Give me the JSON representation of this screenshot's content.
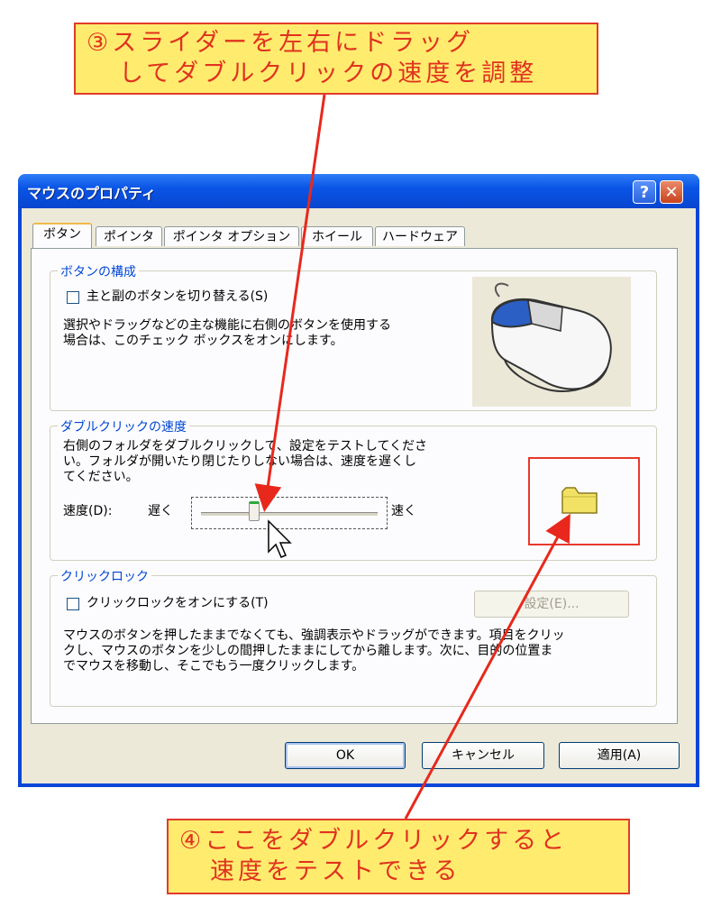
{
  "annotations": {
    "top_line1": "③スライダーを左右にドラッグ",
    "top_line2": "してダブルクリックの速度を調整",
    "bottom_line1": "④ここをダブルクリックすると",
    "bottom_line2": "速度をテストできる",
    "color": "#e0321f",
    "bg": "#ffec6e"
  },
  "window": {
    "title": "マウスのプロパティ",
    "help_glyph": "?",
    "close_glyph": "✕"
  },
  "tabs": [
    "ボタン",
    "ポインタ",
    "ポインタ オプション",
    "ホイール",
    "ハードウェア"
  ],
  "button_config": {
    "group_label": "ボタンの構成",
    "checkbox_label": "主と副のボタンを切り替える(S)",
    "desc_line1": "選択やドラッグなどの主な機能に右側のボタンを使用する",
    "desc_line2": "場合は、このチェック ボックスをオンにします。",
    "image_icon": "mouse-icon"
  },
  "double_click": {
    "group_label": "ダブルクリックの速度",
    "desc_line1": "右側のフォルダをダブルクリックして、設定をテストしてくださ",
    "desc_line2": "い。フォルダが開いたり閉じたりしない場合は、速度を遅くし",
    "desc_line3": "てください。",
    "speed_label": "速度(D):",
    "slow_label": "遅く",
    "fast_label": "速く",
    "slider_value": 0.3,
    "test_icon": "folder-icon"
  },
  "click_lock": {
    "group_label": "クリックロック",
    "checkbox_label": "クリックロックをオンにする(T)",
    "settings_button": "設定(E)...",
    "desc_line1": "マウスのボタンを押したままでなくても、強調表示やドラッグができます。項目をクリッ",
    "desc_line2": "クし、マウスのボタンを少しの間押したままにしてから離します。次に、目的の位置ま",
    "desc_line3": "でマウスを移動し、そこでもう一度クリックします。"
  },
  "footer": {
    "ok": "OK",
    "cancel": "キャンセル",
    "apply": "適用(A)"
  }
}
